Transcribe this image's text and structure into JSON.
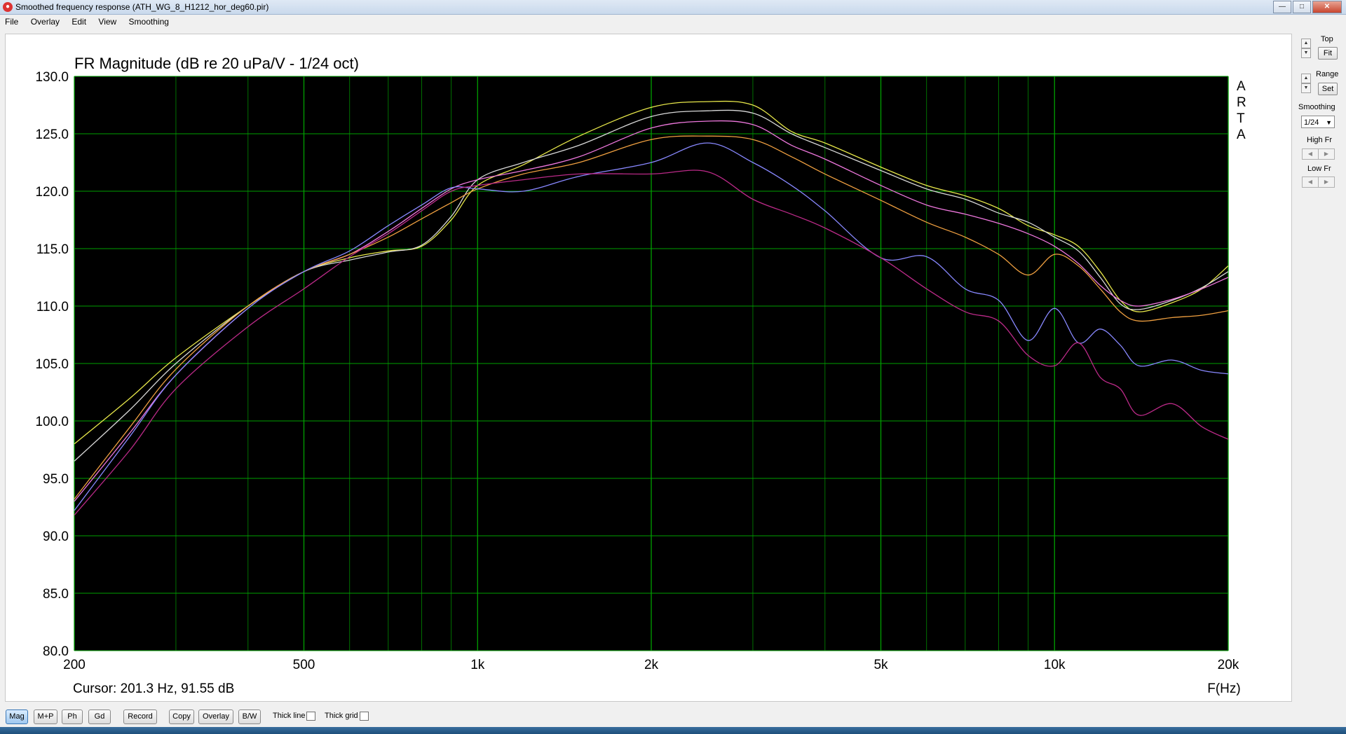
{
  "window": {
    "title": "Smoothed frequency response (ATH_WG_8_H1212_hor_deg60.pir)",
    "icon": "arta-app-icon",
    "controls": {
      "minimize": "—",
      "maximize": "□",
      "close": "✕"
    }
  },
  "menu": [
    "File",
    "Overlay",
    "Edit",
    "View",
    "Smoothing"
  ],
  "plot": {
    "title": "FR Magnitude (dB re 20 uPa/V - 1/24 oct)",
    "watermark": [
      "A",
      "R",
      "T",
      "A"
    ],
    "cursor_text": "Cursor: 201.3 Hz, 91.55 dB",
    "x_axis_label": "F(Hz)",
    "background": "#000000",
    "grid_color": "#00a000"
  },
  "chart_data": {
    "type": "line",
    "title": "FR Magnitude (dB re 20 uPa/V - 1/24 oct)",
    "xlabel": "F(Hz)",
    "ylabel": "",
    "xscale": "log",
    "xlim": [
      200,
      20000
    ],
    "ylim": [
      80,
      130
    ],
    "grid": true,
    "y_ticks": [
      {
        "v": 130,
        "label": "130.0"
      },
      {
        "v": 125,
        "label": "125.0"
      },
      {
        "v": 120,
        "label": "120.0"
      },
      {
        "v": 115,
        "label": "115.0"
      },
      {
        "v": 110,
        "label": "110.0"
      },
      {
        "v": 105,
        "label": "105.0"
      },
      {
        "v": 100,
        "label": "100.0"
      },
      {
        "v": 95,
        "label": "95.0"
      },
      {
        "v": 90,
        "label": "90.0"
      },
      {
        "v": 85,
        "label": "85.0"
      },
      {
        "v": 80,
        "label": "80.0"
      }
    ],
    "x_ticks": [
      {
        "v": 200,
        "label": "200"
      },
      {
        "v": 500,
        "label": "500"
      },
      {
        "v": 1000,
        "label": "1k"
      },
      {
        "v": 2000,
        "label": "2k"
      },
      {
        "v": 5000,
        "label": "5k"
      },
      {
        "v": 10000,
        "label": "10k"
      },
      {
        "v": 20000,
        "label": "20k"
      }
    ],
    "x_minor_grid": [
      300,
      400,
      600,
      700,
      800,
      900,
      3000,
      4000,
      6000,
      7000,
      8000,
      9000
    ],
    "series": [
      {
        "color": "#e8e84a",
        "points": [
          [
            200,
            98
          ],
          [
            250,
            102
          ],
          [
            300,
            105.5
          ],
          [
            400,
            110
          ],
          [
            500,
            113
          ],
          [
            600,
            114.2
          ],
          [
            700,
            114.8
          ],
          [
            800,
            115.2
          ],
          [
            900,
            117.5
          ],
          [
            1000,
            120.5
          ],
          [
            1200,
            122.3
          ],
          [
            1500,
            124.8
          ],
          [
            2000,
            127.3
          ],
          [
            2500,
            127.8
          ],
          [
            3000,
            127.5
          ],
          [
            3500,
            125.2
          ],
          [
            4000,
            124.2
          ],
          [
            5000,
            122.1
          ],
          [
            6000,
            120.5
          ],
          [
            7000,
            119.6
          ],
          [
            8000,
            118.5
          ],
          [
            9000,
            117
          ],
          [
            10000,
            116.2
          ],
          [
            11000,
            115.2
          ],
          [
            12000,
            113
          ],
          [
            13000,
            110.5
          ],
          [
            14000,
            109.5
          ],
          [
            16000,
            110.3
          ],
          [
            18000,
            111.5
          ],
          [
            20000,
            113.5
          ]
        ]
      },
      {
        "color": "#d8d8d8",
        "points": [
          [
            200,
            96.5
          ],
          [
            250,
            101
          ],
          [
            300,
            105
          ],
          [
            400,
            110
          ],
          [
            500,
            113
          ],
          [
            600,
            114
          ],
          [
            700,
            114.7
          ],
          [
            800,
            115.3
          ],
          [
            900,
            117.8
          ],
          [
            1000,
            121
          ],
          [
            1200,
            122.5
          ],
          [
            1500,
            124
          ],
          [
            2000,
            126.5
          ],
          [
            2500,
            127
          ],
          [
            3000,
            126.8
          ],
          [
            3500,
            125
          ],
          [
            4000,
            123.8
          ],
          [
            5000,
            121.8
          ],
          [
            6000,
            120.2
          ],
          [
            7000,
            119.3
          ],
          [
            8000,
            118.1
          ],
          [
            9000,
            117.3
          ],
          [
            10000,
            116
          ],
          [
            11000,
            114.8
          ],
          [
            12000,
            112.5
          ],
          [
            13000,
            110.2
          ],
          [
            14000,
            109.7
          ],
          [
            16000,
            110.5
          ],
          [
            18000,
            111.6
          ],
          [
            20000,
            113
          ]
        ]
      },
      {
        "color": "#ee77dd",
        "points": [
          [
            200,
            93
          ],
          [
            250,
            99
          ],
          [
            300,
            104
          ],
          [
            400,
            109.8
          ],
          [
            500,
            113
          ],
          [
            600,
            114.5
          ],
          [
            700,
            116.5
          ],
          [
            800,
            118.5
          ],
          [
            900,
            120.2
          ],
          [
            1000,
            121
          ],
          [
            1200,
            121.8
          ],
          [
            1500,
            123
          ],
          [
            2000,
            125.5
          ],
          [
            2500,
            126.1
          ],
          [
            3000,
            125.8
          ],
          [
            3500,
            124
          ],
          [
            4000,
            122.8
          ],
          [
            5000,
            120.5
          ],
          [
            6000,
            118.8
          ],
          [
            7000,
            118
          ],
          [
            8000,
            117.2
          ],
          [
            9000,
            116.3
          ],
          [
            10000,
            115.2
          ],
          [
            11000,
            113.7
          ],
          [
            12000,
            111.8
          ],
          [
            13000,
            110.5
          ],
          [
            14000,
            110
          ],
          [
            16000,
            110.6
          ],
          [
            18000,
            111.5
          ],
          [
            20000,
            112.5
          ]
        ]
      },
      {
        "color": "#f0a040",
        "points": [
          [
            200,
            93.2
          ],
          [
            250,
            99.5
          ],
          [
            300,
            104.5
          ],
          [
            400,
            110
          ],
          [
            500,
            113
          ],
          [
            600,
            114.5
          ],
          [
            700,
            116
          ],
          [
            800,
            117.6
          ],
          [
            900,
            119
          ],
          [
            1000,
            120.2
          ],
          [
            1200,
            121.5
          ],
          [
            1500,
            122.5
          ],
          [
            2000,
            124.5
          ],
          [
            2500,
            124.8
          ],
          [
            3000,
            124.5
          ],
          [
            3500,
            123
          ],
          [
            4000,
            121.5
          ],
          [
            5000,
            119.2
          ],
          [
            6000,
            117.3
          ],
          [
            7000,
            116
          ],
          [
            8000,
            114.5
          ],
          [
            9000,
            112.7
          ],
          [
            10000,
            114.5
          ],
          [
            11000,
            113.5
          ],
          [
            12000,
            111.5
          ],
          [
            13000,
            109.5
          ],
          [
            14000,
            108.7
          ],
          [
            16000,
            109
          ],
          [
            18000,
            109.2
          ],
          [
            20000,
            109.6
          ]
        ]
      },
      {
        "color": "#8888ff",
        "points": [
          [
            200,
            92.2
          ],
          [
            250,
            98.7
          ],
          [
            300,
            104
          ],
          [
            400,
            109.8
          ],
          [
            500,
            113
          ],
          [
            600,
            114.8
          ],
          [
            700,
            117
          ],
          [
            800,
            118.8
          ],
          [
            900,
            120.3
          ],
          [
            1000,
            120.2
          ],
          [
            1200,
            120
          ],
          [
            1500,
            121.3
          ],
          [
            2000,
            122.5
          ],
          [
            2500,
            124.2
          ],
          [
            3000,
            122.5
          ],
          [
            3500,
            120.5
          ],
          [
            4000,
            118.3
          ],
          [
            5000,
            114.2
          ],
          [
            6000,
            114.3
          ],
          [
            7000,
            111.5
          ],
          [
            8000,
            110.5
          ],
          [
            9000,
            107
          ],
          [
            10000,
            109.8
          ],
          [
            11000,
            106.8
          ],
          [
            12000,
            108
          ],
          [
            13000,
            106.6
          ],
          [
            14000,
            104.8
          ],
          [
            16000,
            105.3
          ],
          [
            18000,
            104.4
          ],
          [
            20000,
            104.1
          ]
        ]
      },
      {
        "color": "#bb2a88",
        "points": [
          [
            200,
            91.8
          ],
          [
            250,
            97.5
          ],
          [
            300,
            102.8
          ],
          [
            400,
            108.2
          ],
          [
            500,
            111.5
          ],
          [
            600,
            114.3
          ],
          [
            700,
            116.3
          ],
          [
            800,
            118.3
          ],
          [
            900,
            120
          ],
          [
            1000,
            120.5
          ],
          [
            1200,
            121
          ],
          [
            1500,
            121.5
          ],
          [
            2000,
            121.5
          ],
          [
            2500,
            121.7
          ],
          [
            3000,
            119.3
          ],
          [
            3500,
            118
          ],
          [
            4000,
            116.8
          ],
          [
            5000,
            114.2
          ],
          [
            6000,
            111.5
          ],
          [
            7000,
            109.5
          ],
          [
            8000,
            108.7
          ],
          [
            9000,
            105.7
          ],
          [
            10000,
            104.8
          ],
          [
            11000,
            106.8
          ],
          [
            12000,
            103.8
          ],
          [
            13000,
            102.8
          ],
          [
            14000,
            100.5
          ],
          [
            16000,
            101.5
          ],
          [
            18000,
            99.5
          ],
          [
            20000,
            98.4
          ]
        ]
      }
    ]
  },
  "side_panel": {
    "top_label": "Top",
    "fit_label": "Fit",
    "range_label": "Range",
    "set_label": "Set",
    "smoothing_label": "Smoothing",
    "smoothing_value": "1/24",
    "high_fr_label": "High Fr",
    "low_fr_label": "Low Fr",
    "up_glyph": "▲",
    "down_glyph": "▼",
    "left_glyph": "◀",
    "right_glyph": "▶"
  },
  "toolbar": {
    "mag": "Mag",
    "mp": "M+P",
    "ph": "Ph",
    "gd": "Gd",
    "record": "Record",
    "copy": "Copy",
    "overlay": "Overlay",
    "bw": "B/W",
    "thick_line": "Thick line",
    "thick_grid": "Thick grid"
  }
}
